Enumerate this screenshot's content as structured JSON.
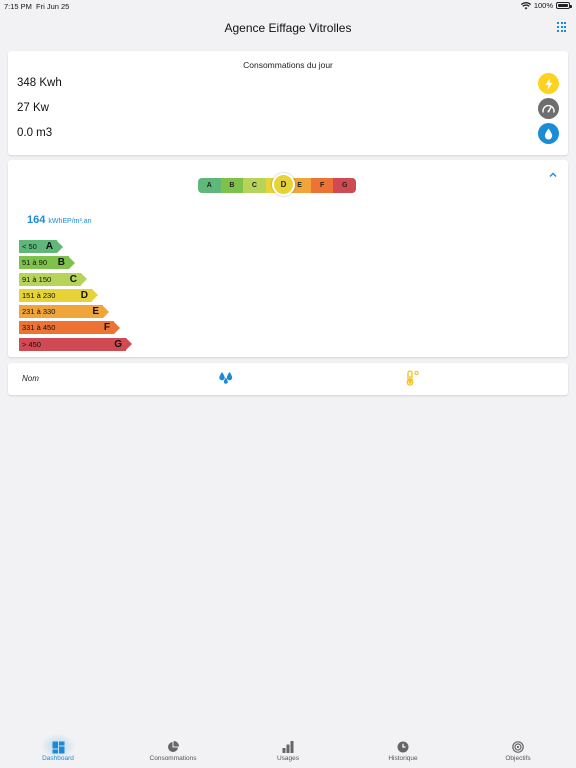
{
  "status": {
    "time": "7:15 PM",
    "date": "Fri Jun 25",
    "battery": "100%"
  },
  "header": {
    "title": "Agence Eiffage Vitrolles"
  },
  "consumption": {
    "title": "Consommations du jour",
    "rows": [
      {
        "value": "348 Kwh",
        "icon": "lightning-icon",
        "color": "#ffd21f"
      },
      {
        "value": "27 Kw",
        "icon": "gauge-icon",
        "color": "#6e6e6e"
      },
      {
        "value": "0.0 m3",
        "icon": "water-drop-icon",
        "color": "#1a8bd6"
      }
    ]
  },
  "dpe": {
    "scale_letters": [
      "A",
      "B",
      "C",
      "D",
      "E",
      "F",
      "G"
    ],
    "current": "D",
    "value": "164",
    "unit": "kWhEP/m².an",
    "bars": [
      {
        "range": "< 50",
        "letter": "A",
        "color": "#5fb87a"
      },
      {
        "range": "51 à 90",
        "letter": "B",
        "color": "#7ec24c"
      },
      {
        "range": "91 à 150",
        "letter": "C",
        "color": "#b6d35a"
      },
      {
        "range": "151 à 230",
        "letter": "D",
        "color": "#e8d336"
      },
      {
        "range": "231 à 330",
        "letter": "E",
        "color": "#f0a53a"
      },
      {
        "range": "331 à 450",
        "letter": "F",
        "color": "#ec7334"
      },
      {
        "range": "> 450",
        "letter": "G",
        "color": "#cf4a52"
      }
    ]
  },
  "nom_card": {
    "label": "Nom"
  },
  "tabs": [
    {
      "label": "Dashboard",
      "icon": "dashboard-icon",
      "active": true
    },
    {
      "label": "Consommations",
      "icon": "pie-chart-icon",
      "active": false
    },
    {
      "label": "Usages",
      "icon": "bar-chart-icon",
      "active": false
    },
    {
      "label": "Historique",
      "icon": "clock-icon",
      "active": false
    },
    {
      "label": "Objectifs",
      "icon": "target-icon",
      "active": false
    }
  ]
}
